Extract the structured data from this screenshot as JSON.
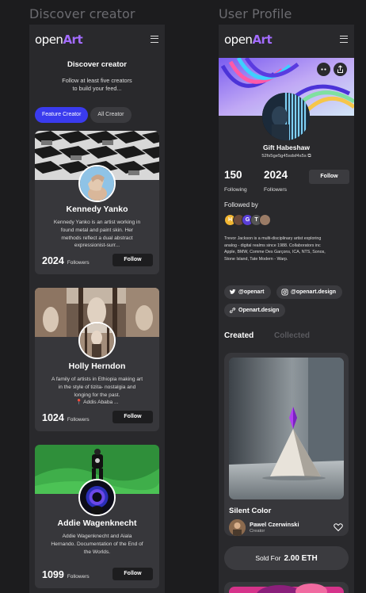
{
  "sections": {
    "left": "Discover creator",
    "right": "User Profile"
  },
  "logo": {
    "open": "open",
    "art": "Art"
  },
  "discover": {
    "title": "Discover creator",
    "subtitle_1": "Follow at least five creators",
    "subtitle_2": "to build your feed...",
    "tabs": [
      "Feature Creator",
      "All Creator"
    ],
    "creators": [
      {
        "name": "Kennedy Yanko",
        "bio_lines": [
          "Kennedy Yanko is an artist working in",
          "found metal and paint skin. Her",
          "methods reflect a dual abstract",
          "expressionist-surr..."
        ],
        "followers": "2024",
        "followers_label": "Followers",
        "follow_label": "Follow"
      },
      {
        "name": "Holly Herndon",
        "bio_lines": [
          "A family of artists in Ethiopia making art",
          "in the style of tizita- nostalgia and",
          "longing for the past.",
          "📍 Addis Ababa ..."
        ],
        "followers": "1024",
        "followers_label": "Followers",
        "follow_label": "Follow"
      },
      {
        "name": "Addie Wagenknecht",
        "bio_lines": [
          "Addie Wagenknecht and Aiala",
          "Hernando. Documentation of the End of",
          "the Worlds."
        ],
        "followers": "1099",
        "followers_label": "Followers",
        "follow_label": "Follow"
      }
    ]
  },
  "profile": {
    "name": "Gift Habeshaw",
    "address": "52fs5ge5g45sdsf4s5s",
    "following": "150",
    "following_label": "Following",
    "followers": "2024",
    "followers_label": "Followers",
    "follow_label": "Follow",
    "followed_by_label": "Followed by",
    "followed_by_initials": [
      "H",
      "",
      "G",
      "T",
      ""
    ],
    "bio_lines": [
      "Trevor Jackson is a multi-disciplinary artist exploring",
      "analog - digital realms since 1988. Collaborators inc",
      "Apple, BMW, Comme Des Garçons, ICA, NTS, Sonos,",
      "Stone Island, Tate Modern - Warp."
    ],
    "links": [
      "@openart",
      "@openart.design",
      "Openart.design"
    ],
    "tabs": [
      "Created",
      "Collected"
    ],
    "nft": {
      "title": "Silent Color",
      "owner": "Pawel Czerwinski",
      "owner_role": "Creator",
      "sold_label": "Sold For",
      "price": "2.00 ETH"
    }
  },
  "colors": {
    "background": "#1c1c1e",
    "panel": "#29292c",
    "card": "#37373b",
    "accent_tab": "#3a3bee",
    "logo_accent": "#a36cff"
  }
}
